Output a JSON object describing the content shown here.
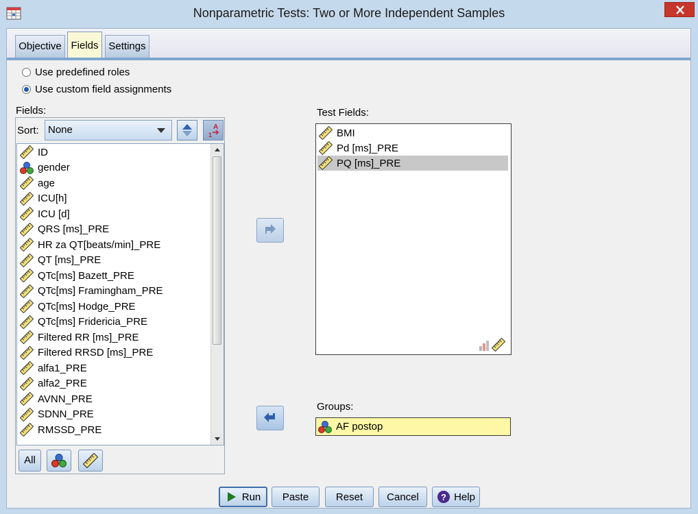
{
  "window": {
    "title": "Nonparametric Tests: Two or More Independent Samples",
    "close_icon": "close-icon"
  },
  "tabs": [
    {
      "label": "Objective",
      "active": false
    },
    {
      "label": "Fields",
      "active": true
    },
    {
      "label": "Settings",
      "active": false
    }
  ],
  "roles": {
    "predefined": {
      "label": "Use predefined roles",
      "selected": false
    },
    "custom": {
      "label": "Use custom field assignments",
      "selected": true
    }
  },
  "fields": {
    "heading": "Fields:",
    "sort_label": "Sort:",
    "sort_value": "None",
    "items": [
      {
        "label": "ID",
        "icon": "scale-ruler-icon"
      },
      {
        "label": "gender",
        "icon": "nominal-balls-icon"
      },
      {
        "label": "age",
        "icon": "scale-ruler-icon"
      },
      {
        "label": "ICU[h]",
        "icon": "scale-ruler-icon"
      },
      {
        "label": "ICU [d]",
        "icon": "scale-ruler-icon"
      },
      {
        "label": "QRS [ms]_PRE",
        "icon": "scale-ruler-icon"
      },
      {
        "label": "HR za QT[beats/min]_PRE",
        "icon": "scale-ruler-icon"
      },
      {
        "label": "QT [ms]_PRE",
        "icon": "scale-ruler-icon"
      },
      {
        "label": "QTc[ms] Bazett_PRE",
        "icon": "scale-ruler-icon"
      },
      {
        "label": "QTc[ms] Framingham_PRE",
        "icon": "scale-ruler-icon"
      },
      {
        "label": "QTc[ms] Hodge_PRE",
        "icon": "scale-ruler-icon"
      },
      {
        "label": "QTc[ms] Fridericia_PRE",
        "icon": "scale-ruler-icon"
      },
      {
        "label": "Filtered RR [ms]_PRE",
        "icon": "scale-ruler-icon"
      },
      {
        "label": "Filtered RRSD [ms]_PRE",
        "icon": "scale-ruler-icon"
      },
      {
        "label": "alfa1_PRE",
        "icon": "scale-ruler-icon"
      },
      {
        "label": "alfa2_PRE",
        "icon": "scale-ruler-icon"
      },
      {
        "label": "AVNN_PRE",
        "icon": "scale-ruler-icon"
      },
      {
        "label": "SDNN_PRE",
        "icon": "scale-ruler-icon"
      },
      {
        "label": "RMSSD_PRE",
        "icon": "scale-ruler-icon"
      }
    ],
    "filter_all_label": "All"
  },
  "test_fields": {
    "heading": "Test Fields:",
    "items": [
      {
        "label": "BMI",
        "selected": false
      },
      {
        "label": "Pd [ms]_PRE",
        "selected": false
      },
      {
        "label": "PQ [ms]_PRE",
        "selected": true
      }
    ]
  },
  "groups": {
    "heading": "Groups:",
    "value": "AF postop"
  },
  "buttons": {
    "run": "Run",
    "paste": "Paste",
    "reset": "Reset",
    "cancel": "Cancel",
    "help": "Help"
  },
  "colors": {
    "accent": "#7fa7cf",
    "groups_fill": "#fdf7a6",
    "close": "#c7362b"
  }
}
